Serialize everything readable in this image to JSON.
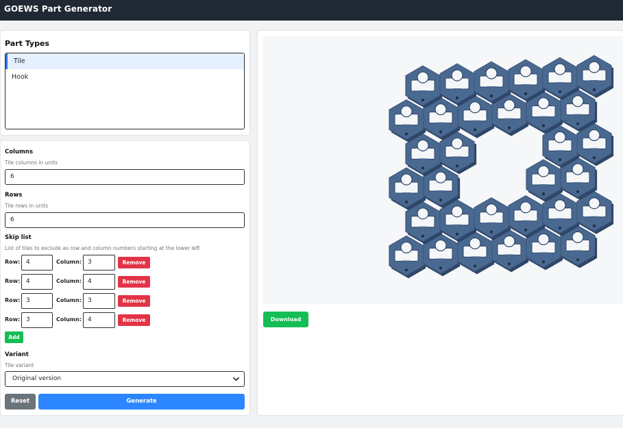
{
  "app": {
    "title": "GOEWS Part Generator"
  },
  "part_types": {
    "heading": "Part Types",
    "items": [
      {
        "label": "Tile",
        "selected": true
      },
      {
        "label": "Hook",
        "selected": false
      }
    ]
  },
  "form": {
    "columns": {
      "label": "Columns",
      "hint": "Tile columns in units",
      "value": "6"
    },
    "rows": {
      "label": "Rows",
      "hint": "Tile rows in units",
      "value": "6"
    },
    "skip_list": {
      "label": "Skip list",
      "hint": "List of tiles to exclude as row and column numbers starting at the lower left",
      "row_label": "Row:",
      "column_label": "Column:",
      "remove_label": "Remove",
      "entries": [
        {
          "row": "4",
          "column": "3"
        },
        {
          "row": "4",
          "column": "4"
        },
        {
          "row": "3",
          "column": "3"
        },
        {
          "row": "3",
          "column": "4"
        }
      ],
      "add_label": "Add"
    },
    "variant": {
      "label": "Variant",
      "hint": "Tile variant",
      "selected": "Original version"
    },
    "reset_label": "Reset",
    "generate_label": "Generate"
  },
  "preview": {
    "download_label": "Download",
    "model_color": "#4a6990"
  },
  "colors": {
    "navbar": "#1f2833",
    "danger": "#e23446",
    "success": "#15bd55",
    "primary": "#2c86ff",
    "secondary": "#6b737b"
  }
}
